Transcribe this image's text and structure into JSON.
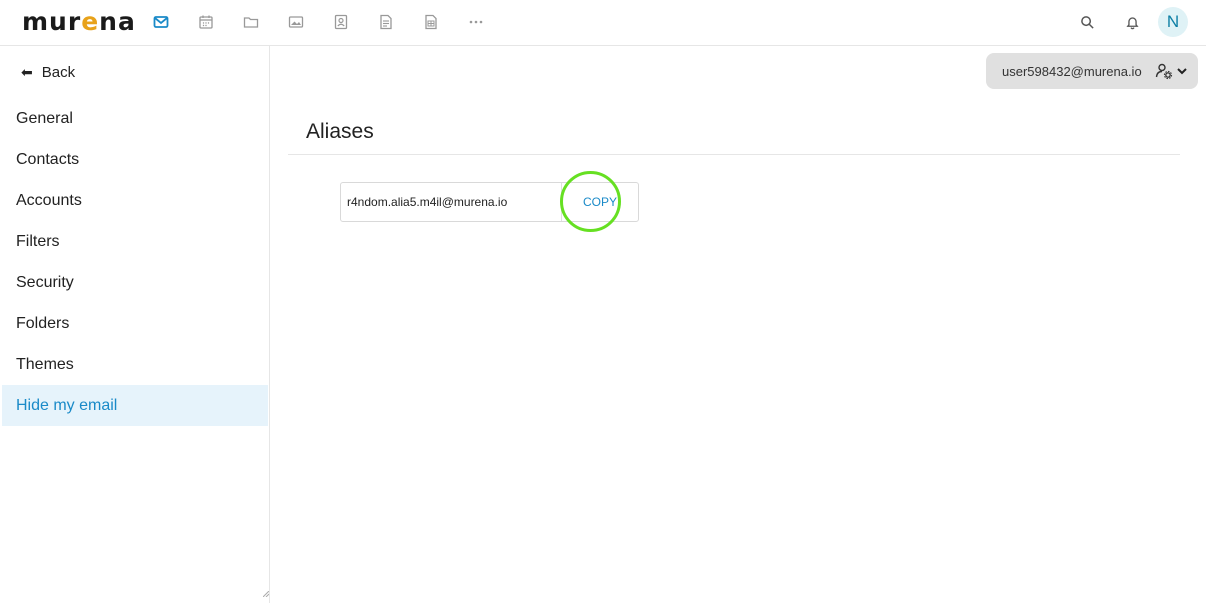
{
  "header": {
    "logo": {
      "pre": "mur",
      "e": "e",
      "post": "na"
    },
    "apps": [
      {
        "icon": "mail-icon",
        "active": true
      },
      {
        "icon": "calendar-icon"
      },
      {
        "icon": "folder-icon"
      },
      {
        "icon": "photos-icon"
      },
      {
        "icon": "contacts-icon"
      },
      {
        "icon": "notes-icon"
      },
      {
        "icon": "spreadsheet-icon"
      },
      {
        "icon": "more-icon"
      }
    ],
    "avatar_initial": "N"
  },
  "sidebar": {
    "back_label": "Back",
    "items": [
      {
        "label": "General"
      },
      {
        "label": "Contacts"
      },
      {
        "label": "Accounts"
      },
      {
        "label": "Filters"
      },
      {
        "label": "Security"
      },
      {
        "label": "Folders"
      },
      {
        "label": "Themes"
      },
      {
        "label": "Hide my email",
        "active": true
      }
    ]
  },
  "account": {
    "email": "user598432@murena.io"
  },
  "main": {
    "title": "Aliases",
    "alias": "r4ndom.alia5.m4il@murena.io",
    "copy_label": "COPY"
  },
  "colors": {
    "accent": "#1a8ac8",
    "highlight": "#66e022",
    "brand_e": "#e8a21a"
  }
}
